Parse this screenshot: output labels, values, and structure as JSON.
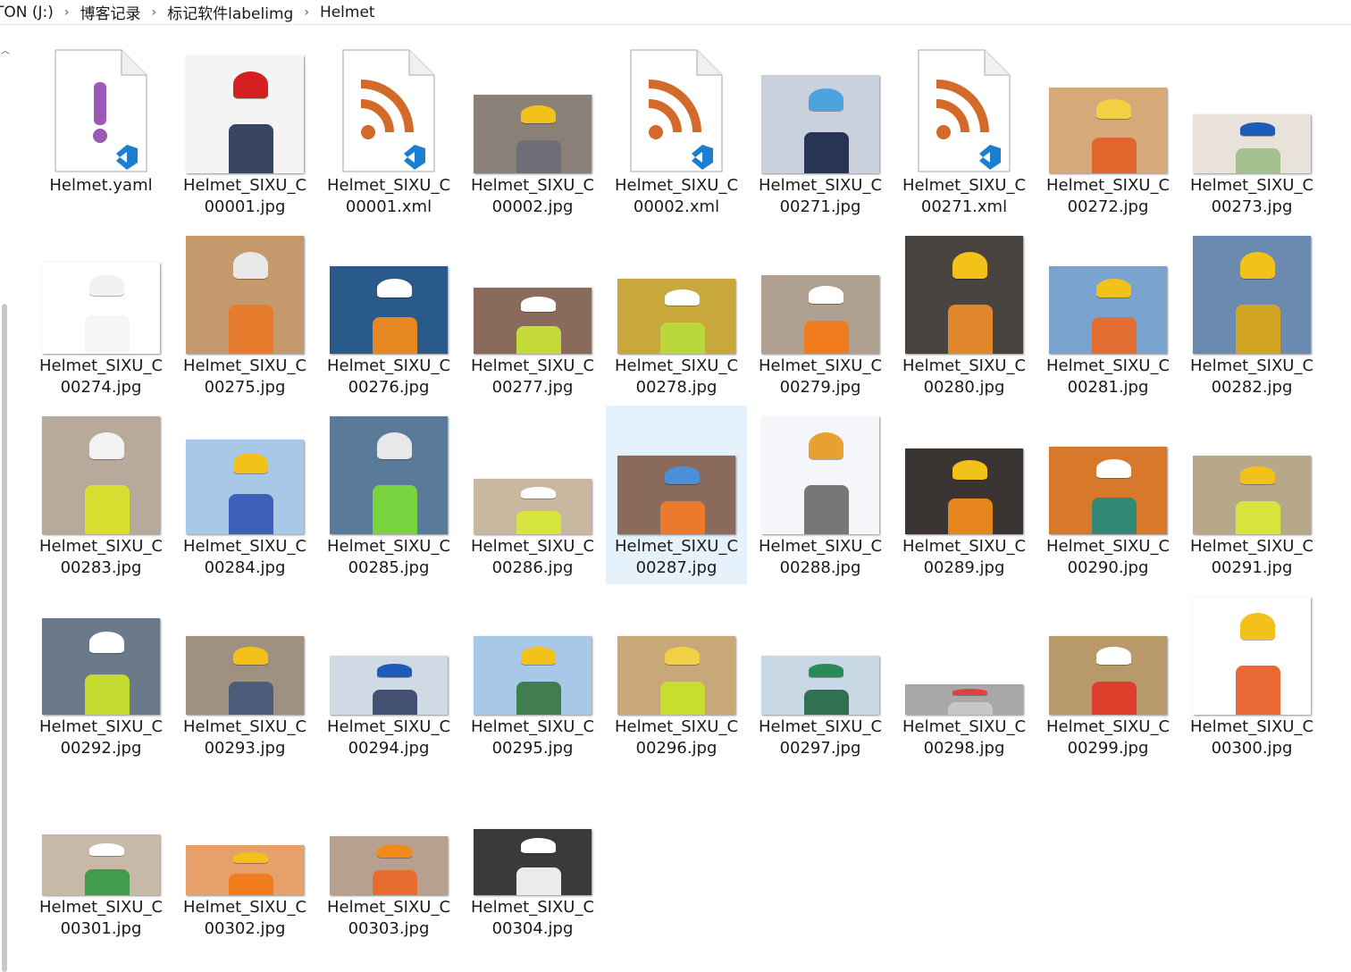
{
  "breadcrumb": [
    "TON (J:)",
    "博客记录",
    "标记软件labelimg",
    "Helmet"
  ],
  "colors": {
    "selection": "#e5f1fb",
    "rss": "#d46a2a",
    "yaml_mark": "#9b59b6",
    "vscode": "#1b7fd1"
  },
  "files": [
    {
      "l1": "Helmet.yaml",
      "l2": "",
      "kind": "yaml",
      "h": 110,
      "hat": "#d7d7d7",
      "vest": "#d7d7d7"
    },
    {
      "l1": "Helmet_SIXU_C",
      "l2": "00001.jpg",
      "kind": "photo",
      "h": 132,
      "hat": "#d42020",
      "vest": "#2e3c5a",
      "bg": "#f4f4f4"
    },
    {
      "l1": "Helmet_SIXU_C",
      "l2": "00001.xml",
      "kind": "xml",
      "h": 110
    },
    {
      "l1": "Helmet_SIXU_C",
      "l2": "00002.jpg",
      "kind": "photo",
      "h": 88,
      "hat": "#f2c21a",
      "vest": "#6d6d78",
      "bg": "#8b8078"
    },
    {
      "l1": "Helmet_SIXU_C",
      "l2": "00002.xml",
      "kind": "xml",
      "h": 110
    },
    {
      "l1": "Helmet_SIXU_C",
      "l2": "00271.jpg",
      "kind": "photo",
      "h": 110,
      "hat": "#4da3e0",
      "vest": "#1f2b4e",
      "bg": "#c9d2dc"
    },
    {
      "l1": "Helmet_SIXU_C",
      "l2": "00271.xml",
      "kind": "xml",
      "h": 110
    },
    {
      "l1": "Helmet_SIXU_C",
      "l2": "00272.jpg",
      "kind": "photo",
      "h": 96,
      "hat": "#f2d043",
      "vest": "#e0622a",
      "bg": "#d6a87a"
    },
    {
      "l1": "Helmet_SIXU_C",
      "l2": "00273.jpg",
      "kind": "photo",
      "h": 66,
      "hat": "#1f5bb8",
      "vest": "#9fbf8a",
      "bg": "#e9e2da"
    },
    {
      "l1": "Helmet_SIXU_C",
      "l2": "00274.jpg",
      "kind": "photo",
      "h": 102,
      "hat": "#f1f1f1",
      "vest": "#f6f6f6",
      "bg": "#ffffff"
    },
    {
      "l1": "Helmet_SIXU_C",
      "l2": "00275.jpg",
      "kind": "photo",
      "h": 132,
      "hat": "#e8e8e8",
      "vest": "#e8782a",
      "bg": "#c49a6c"
    },
    {
      "l1": "Helmet_SIXU_C",
      "l2": "00276.jpg",
      "kind": "photo",
      "h": 98,
      "hat": "#ffffff",
      "vest": "#f08a1c",
      "bg": "#2a5a8a"
    },
    {
      "l1": "Helmet_SIXU_C",
      "l2": "00277.jpg",
      "kind": "photo",
      "h": 74,
      "hat": "#ffffff",
      "vest": "#c7e03a",
      "bg": "#8a6a5a"
    },
    {
      "l1": "Helmet_SIXU_C",
      "l2": "00278.jpg",
      "kind": "photo",
      "h": 84,
      "hat": "#ffffff",
      "vest": "#b8d83a",
      "bg": "#c8a83a"
    },
    {
      "l1": "Helmet_SIXU_C",
      "l2": "00279.jpg",
      "kind": "photo",
      "h": 88,
      "hat": "#ffffff",
      "vest": "#f47a1a",
      "bg": "#b0a090"
    },
    {
      "l1": "Helmet_SIXU_C",
      "l2": "00280.jpg",
      "kind": "photo",
      "h": 132,
      "hat": "#f2c21a",
      "vest": "#e88a2a",
      "bg": "#4a4440"
    },
    {
      "l1": "Helmet_SIXU_C",
      "l2": "00281.jpg",
      "kind": "photo",
      "h": 98,
      "hat": "#f2c21a",
      "vest": "#e86a2a",
      "bg": "#7aa4cf"
    },
    {
      "l1": "Helmet_SIXU_C",
      "l2": "00282.jpg",
      "kind": "photo",
      "h": 132,
      "hat": "#f2c21a",
      "vest": "#d8a818",
      "bg": "#6a8ab0"
    },
    {
      "l1": "Helmet_SIXU_C",
      "l2": "00283.jpg",
      "kind": "photo",
      "h": 132,
      "hat": "#f2f2f2",
      "vest": "#d8e02a",
      "bg": "#b8aa9a"
    },
    {
      "l1": "Helmet_SIXU_C",
      "l2": "00284.jpg",
      "kind": "photo",
      "h": 106,
      "hat": "#f2c21a",
      "vest": "#3a5ab8",
      "bg": "#a8c8e8"
    },
    {
      "l1": "Helmet_SIXU_C",
      "l2": "00285.jpg",
      "kind": "photo",
      "h": 132,
      "hat": "#e8e8e8",
      "vest": "#7ad83a",
      "bg": "#5a7a9a"
    },
    {
      "l1": "Helmet_SIXU_C",
      "l2": "00286.jpg",
      "kind": "photo",
      "h": 62,
      "hat": "#ffffff",
      "vest": "#d8e83a",
      "bg": "#c8b8a0"
    },
    {
      "l1": "Helmet_SIXU_C",
      "l2": "00287.jpg",
      "kind": "photo",
      "h": 88,
      "hat": "#4a90d8",
      "vest": "#f07a2a",
      "bg": "#8a6a5a",
      "selected": true
    },
    {
      "l1": "Helmet_SIXU_C",
      "l2": "00288.jpg",
      "kind": "photo",
      "h": 132,
      "hat": "#e8a030",
      "vest": "#707070",
      "bg": "#f4f6fa"
    },
    {
      "l1": "Helmet_SIXU_C",
      "l2": "00289.jpg",
      "kind": "photo",
      "h": 96,
      "hat": "#f2c21a",
      "vest": "#f08a1c",
      "bg": "#3a3432"
    },
    {
      "l1": "Helmet_SIXU_C",
      "l2": "00290.jpg",
      "kind": "photo",
      "h": 98,
      "hat": "#ffffff",
      "vest": "#2a8a7a",
      "bg": "#d8782a"
    },
    {
      "l1": "Helmet_SIXU_C",
      "l2": "00291.jpg",
      "kind": "photo",
      "h": 88,
      "hat": "#f2c21a",
      "vest": "#d8e83a",
      "bg": "#b8a88a"
    },
    {
      "l1": "Helmet_SIXU_C",
      "l2": "00292.jpg",
      "kind": "photo",
      "h": 108,
      "hat": "#ffffff",
      "vest": "#c8e02a",
      "bg": "#6a7a8a"
    },
    {
      "l1": "Helmet_SIXU_C",
      "l2": "00293.jpg",
      "kind": "photo",
      "h": 88,
      "hat": "#f2c21a",
      "vest": "#4a5a7a",
      "bg": "#a09080"
    },
    {
      "l1": "Helmet_SIXU_C",
      "l2": "00294.jpg",
      "kind": "photo",
      "h": 66,
      "hat": "#1f5bb8",
      "vest": "#3a4a6a",
      "bg": "#d0dae4"
    },
    {
      "l1": "Helmet_SIXU_C",
      "l2": "00295.jpg",
      "kind": "photo",
      "h": 88,
      "hat": "#f2c21a",
      "vest": "#3a7a4a",
      "bg": "#a8c8e8"
    },
    {
      "l1": "Helmet_SIXU_C",
      "l2": "00296.jpg",
      "kind": "photo",
      "h": 88,
      "hat": "#f2d043",
      "vest": "#c8e02a",
      "bg": "#c8a878"
    },
    {
      "l1": "Helmet_SIXU_C",
      "l2": "00297.jpg",
      "kind": "photo",
      "h": 66,
      "hat": "#2a8a5a",
      "vest": "#2a6a4a",
      "bg": "#c8d8e4"
    },
    {
      "l1": "Helmet_SIXU_C",
      "l2": "00298.jpg",
      "kind": "photo",
      "h": 34,
      "hat": "#e04040",
      "vest": "#c8c8c8",
      "bg": "#a8a8a8"
    },
    {
      "l1": "Helmet_SIXU_C",
      "l2": "00299.jpg",
      "kind": "photo",
      "h": 88,
      "hat": "#ffffff",
      "vest": "#e03a2a",
      "bg": "#b89a6a"
    },
    {
      "l1": "Helmet_SIXU_C",
      "l2": "00300.jpg",
      "kind": "photo",
      "h": 132,
      "hat": "#f2c21a",
      "vest": "#e8602a",
      "bg": "#ffffff"
    },
    {
      "l1": "Helmet_SIXU_C",
      "l2": "00301.jpg",
      "kind": "photo",
      "h": 68,
      "hat": "#ffffff",
      "vest": "#3a9a4a",
      "bg": "#c8b8a8"
    },
    {
      "l1": "Helmet_SIXU_C",
      "l2": "00302.jpg",
      "kind": "photo",
      "h": 56,
      "hat": "#f2c21a",
      "vest": "#f07a1a",
      "bg": "#e8a06a"
    },
    {
      "l1": "Helmet_SIXU_C",
      "l2": "00303.jpg",
      "kind": "photo",
      "h": 66,
      "hat": "#f08a1c",
      "vest": "#e86a2a",
      "bg": "#b8a090"
    },
    {
      "l1": "Helmet_SIXU_C",
      "l2": "00304.jpg",
      "kind": "photo",
      "h": 74,
      "hat": "#ffffff",
      "vest": "#f4f4f4",
      "bg": "#3a3a3a"
    }
  ]
}
